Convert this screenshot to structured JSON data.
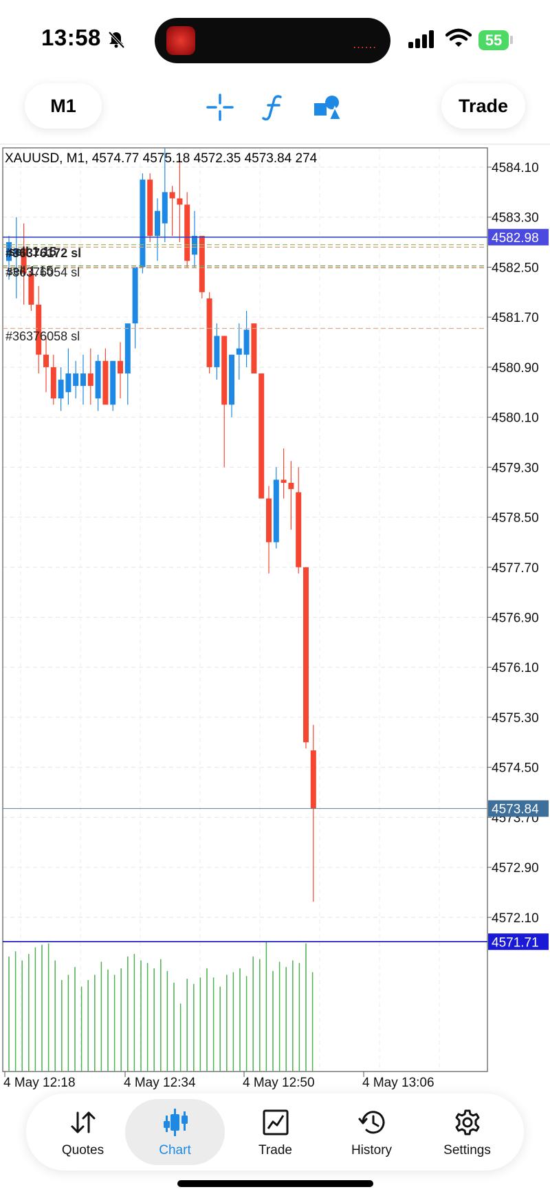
{
  "status": {
    "time": "13:58",
    "battery": "55",
    "island_indicator": "......"
  },
  "toolbar": {
    "timeframe": "M1",
    "tools": [
      "crosshair-icon",
      "indicator-f-icon",
      "objects-icon"
    ],
    "trade_label": "Trade"
  },
  "chart": {
    "header": "XAUUSD, M1, 4574.77 4575.18 4572.35 4573.84 274",
    "price_ticks": [
      "4584.10",
      "4583.30",
      "4582.50",
      "4581.70",
      "4580.90",
      "4580.10",
      "4579.30",
      "4578.50",
      "4577.70",
      "4576.90",
      "4576.10",
      "4575.30",
      "4574.50",
      "4573.70",
      "4572.90",
      "4572.10"
    ],
    "time_labels": [
      "4 May 12:18",
      "4 May 12:34",
      "4 May 12:50",
      "4 May 13:06"
    ],
    "price_badges": {
      "upper_line": "4582.98",
      "bid": "4573.84",
      "lower_line": "4571.71"
    },
    "order_labels": [
      "#36376172 sl",
      "sell 1.15",
      "#36376054 sl",
      "sell 1.15",
      "#36376058 sl"
    ],
    "colors": {
      "bull": "#1e88e5",
      "bear": "#f44630",
      "volume": "#4caf50",
      "blue_line": "#3344cc",
      "bid_line": "#5b7fa3",
      "low_line": "#0000b8"
    }
  },
  "chart_data": {
    "type": "candlestick",
    "title": "XAUUSD, M1, 4574.77 4575.18 4572.35 4573.84 274",
    "ylim": [
      4571.4,
      4584.5
    ],
    "price_lines": [
      4582.98,
      4573.84,
      4571.71,
      4582.86,
      4582.82,
      4582.52,
      4582.49,
      4581.52
    ],
    "candles": [
      {
        "o": 4582.6,
        "h": 4583.0,
        "l": 4582.3,
        "c": 4582.9
      },
      {
        "o": 4582.7,
        "h": 4583.3,
        "l": 4582.0,
        "c": 4582.8
      },
      {
        "o": 4582.8,
        "h": 4583.2,
        "l": 4581.9,
        "c": 4582.4
      },
      {
        "o": 4582.4,
        "h": 4582.5,
        "l": 4581.8,
        "c": 4581.9
      },
      {
        "o": 4581.9,
        "h": 4582.2,
        "l": 4580.8,
        "c": 4581.1
      },
      {
        "o": 4581.1,
        "h": 4581.4,
        "l": 4580.5,
        "c": 4580.9
      },
      {
        "o": 4580.9,
        "h": 4581.1,
        "l": 4580.3,
        "c": 4580.4
      },
      {
        "o": 4580.4,
        "h": 4580.9,
        "l": 4580.2,
        "c": 4580.7
      },
      {
        "o": 4580.5,
        "h": 4581.2,
        "l": 4580.3,
        "c": 4580.8
      },
      {
        "o": 4580.6,
        "h": 4581.0,
        "l": 4580.4,
        "c": 4580.8
      },
      {
        "o": 4580.6,
        "h": 4581.1,
        "l": 4580.3,
        "c": 4580.8
      },
      {
        "o": 4580.8,
        "h": 4581.2,
        "l": 4580.3,
        "c": 4580.6
      },
      {
        "o": 4580.4,
        "h": 4581.1,
        "l": 4580.2,
        "c": 4581.0
      },
      {
        "o": 4581.0,
        "h": 4581.2,
        "l": 4580.3,
        "c": 4580.3
      },
      {
        "o": 4580.3,
        "h": 4581.0,
        "l": 4580.2,
        "c": 4581.0
      },
      {
        "o": 4581.0,
        "h": 4581.3,
        "l": 4580.4,
        "c": 4580.8
      },
      {
        "o": 4580.8,
        "h": 4581.5,
        "l": 4580.3,
        "c": 4581.6
      },
      {
        "o": 4581.6,
        "h": 4582.3,
        "l": 4581.2,
        "c": 4582.5
      },
      {
        "o": 4582.5,
        "h": 4584.0,
        "l": 4582.4,
        "c": 4583.9
      },
      {
        "o": 4583.9,
        "h": 4584.0,
        "l": 4582.9,
        "c": 4583.0
      },
      {
        "o": 4583.0,
        "h": 4583.6,
        "l": 4582.6,
        "c": 4583.4
      },
      {
        "o": 4583.2,
        "h": 4584.4,
        "l": 4582.9,
        "c": 4583.7
      },
      {
        "o": 4583.7,
        "h": 4583.8,
        "l": 4583.0,
        "c": 4583.6
      },
      {
        "o": 4583.6,
        "h": 4584.2,
        "l": 4582.9,
        "c": 4583.5
      },
      {
        "o": 4583.5,
        "h": 4583.7,
        "l": 4582.5,
        "c": 4582.6
      },
      {
        "o": 4582.7,
        "h": 4583.4,
        "l": 4582.5,
        "c": 4583.0
      },
      {
        "o": 4583.0,
        "h": 4583.0,
        "l": 4582.0,
        "c": 4582.1
      },
      {
        "o": 4582.0,
        "h": 4582.1,
        "l": 4580.8,
        "c": 4580.9
      },
      {
        "o": 4580.9,
        "h": 4581.6,
        "l": 4580.7,
        "c": 4581.4
      },
      {
        "o": 4581.4,
        "h": 4581.4,
        "l": 4579.3,
        "c": 4580.3
      },
      {
        "o": 4580.3,
        "h": 4581.1,
        "l": 4580.1,
        "c": 4581.1
      },
      {
        "o": 4581.1,
        "h": 4581.6,
        "l": 4580.7,
        "c": 4581.2
      },
      {
        "o": 4581.1,
        "h": 4581.8,
        "l": 4580.9,
        "c": 4581.5
      },
      {
        "o": 4581.6,
        "h": 4581.6,
        "l": 4580.8,
        "c": 4580.8
      },
      {
        "o": 4580.8,
        "h": 4580.8,
        "l": 4578.8,
        "c": 4578.8
      },
      {
        "o": 4578.8,
        "h": 4579.0,
        "l": 4577.6,
        "c": 4578.1
      },
      {
        "o": 4578.1,
        "h": 4579.3,
        "l": 4578.0,
        "c": 4579.1
      },
      {
        "o": 4579.1,
        "h": 4579.6,
        "l": 4578.8,
        "c": 4579.05
      },
      {
        "o": 4579.05,
        "h": 4579.4,
        "l": 4578.3,
        "c": 4578.95
      },
      {
        "o": 4578.9,
        "h": 4579.3,
        "l": 4577.6,
        "c": 4577.7
      },
      {
        "o": 4577.7,
        "h": 4577.7,
        "l": 4574.8,
        "c": 4574.9
      },
      {
        "o": 4574.77,
        "h": 4575.18,
        "l": 4572.35,
        "c": 4573.84
      }
    ],
    "volumes": [
      0.88,
      0.92,
      0.85,
      0.9,
      0.95,
      0.97,
      0.98,
      0.85,
      0.7,
      0.74,
      0.8,
      0.65,
      0.7,
      0.74,
      0.84,
      0.78,
      0.74,
      0.79,
      0.88,
      0.9,
      0.85,
      0.83,
      0.79,
      0.86,
      0.77,
      0.68,
      0.52,
      0.71,
      0.67,
      0.72,
      0.79,
      0.72,
      0.65,
      0.74,
      0.76,
      0.79,
      0.73,
      0.88,
      0.86,
      0.99,
      0.77,
      0.84,
      0.8,
      0.85,
      0.83,
      0.98,
      0.76
    ],
    "xlabels": [
      "4 May 12:18",
      "4 May 12:34",
      "4 May 12:50",
      "4 May 13:06"
    ]
  },
  "nav": {
    "items": [
      {
        "label": "Quotes",
        "icon": "quotes-arrows-icon"
      },
      {
        "label": "Chart",
        "icon": "candles-icon"
      },
      {
        "label": "Trade",
        "icon": "trade-chart-icon"
      },
      {
        "label": "History",
        "icon": "history-clock-icon"
      },
      {
        "label": "Settings",
        "icon": "gear-icon"
      }
    ],
    "active": "Chart"
  }
}
